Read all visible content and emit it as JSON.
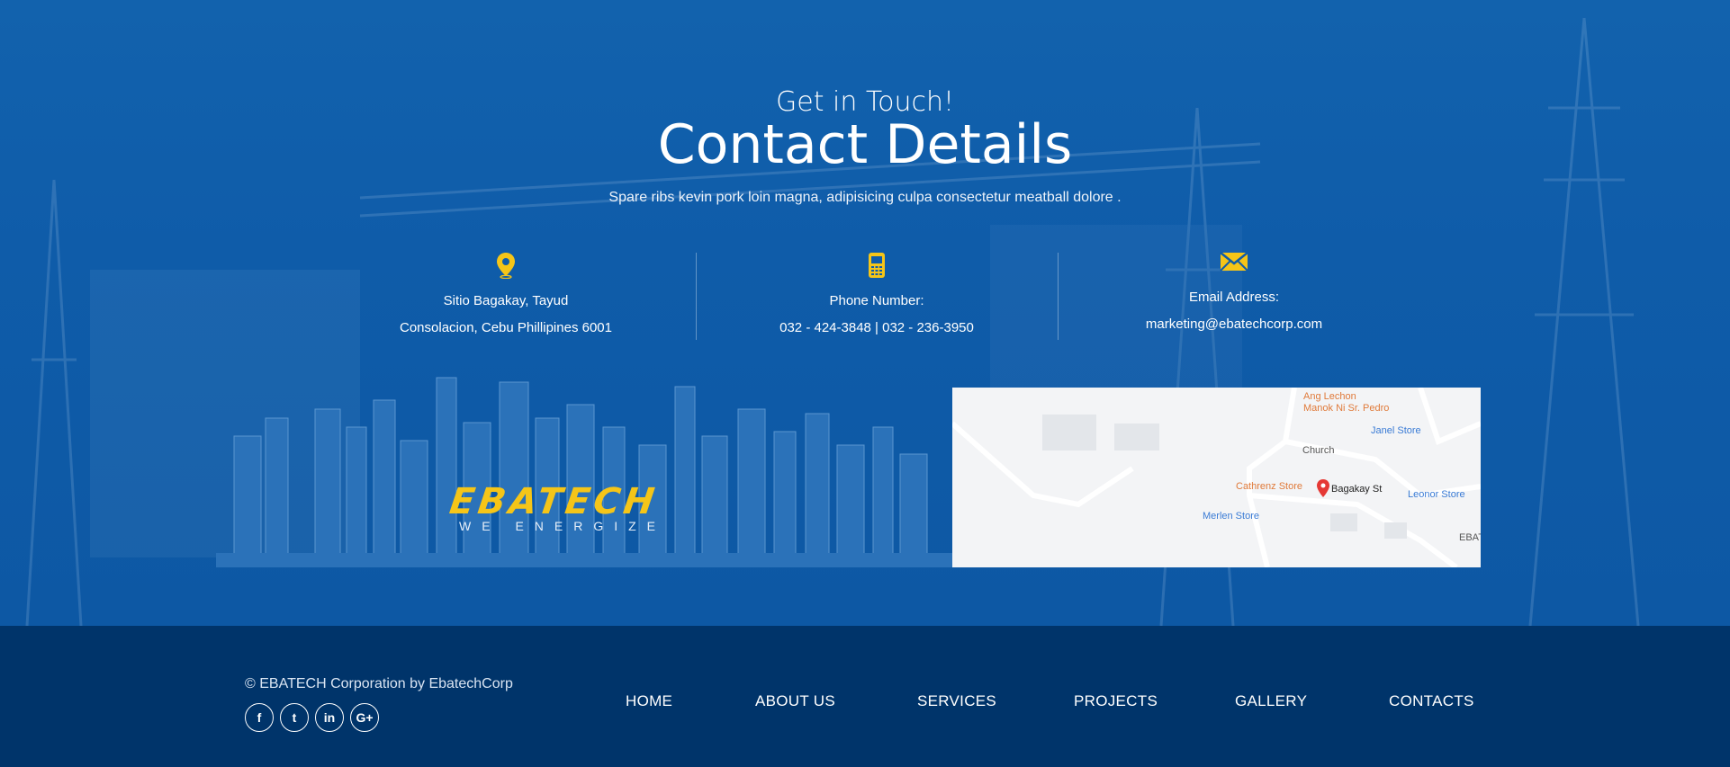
{
  "contact": {
    "pre_title": "Get in Touch!",
    "title": "Contact Details",
    "subtitle": "Spare ribs kevin pork loin magna, adipisicing culpa consectetur meatball dolore ."
  },
  "info": {
    "address": {
      "icon": "map-pin-icon",
      "line1": "Sitio Bagakay, Tayud",
      "line2": "Consolacion, Cebu Phillipines 6001"
    },
    "phone": {
      "icon": "mobile-phone-icon",
      "label": "Phone Number:",
      "value": "032 - 424-3848 | 032 - 236-3950"
    },
    "email": {
      "icon": "envelope-icon",
      "label": "Email Address:",
      "value": "marketing@ebatechcorp.com"
    }
  },
  "logo": {
    "name": "EBATECH",
    "tagline": "WE ENERGIZE"
  },
  "map": {
    "labels": [
      "Ang Lechon",
      "Manok Ni Sr. Pedro",
      "Janel Store",
      "Church",
      "Cathrenz Store",
      "Bagakay St",
      "Merlen Store",
      "Leonor Store",
      "EBAT"
    ]
  },
  "footer": {
    "copyright": "© EBATECH Corporation by EbatechCorp",
    "socials": [
      {
        "name": "facebook-icon",
        "glyph": "f"
      },
      {
        "name": "twitter-icon",
        "glyph": "t"
      },
      {
        "name": "linkedin-icon",
        "glyph": "in"
      },
      {
        "name": "google-plus-icon",
        "glyph": "G+"
      }
    ],
    "nav": [
      "HOME",
      "ABOUT US",
      "SERVICES",
      "PROJECTS",
      "GALLERY",
      "CONTACTS"
    ]
  },
  "colors": {
    "accent": "#f5c518",
    "section_bg": "#0f5ca9",
    "footer_bg": "#00346a"
  }
}
